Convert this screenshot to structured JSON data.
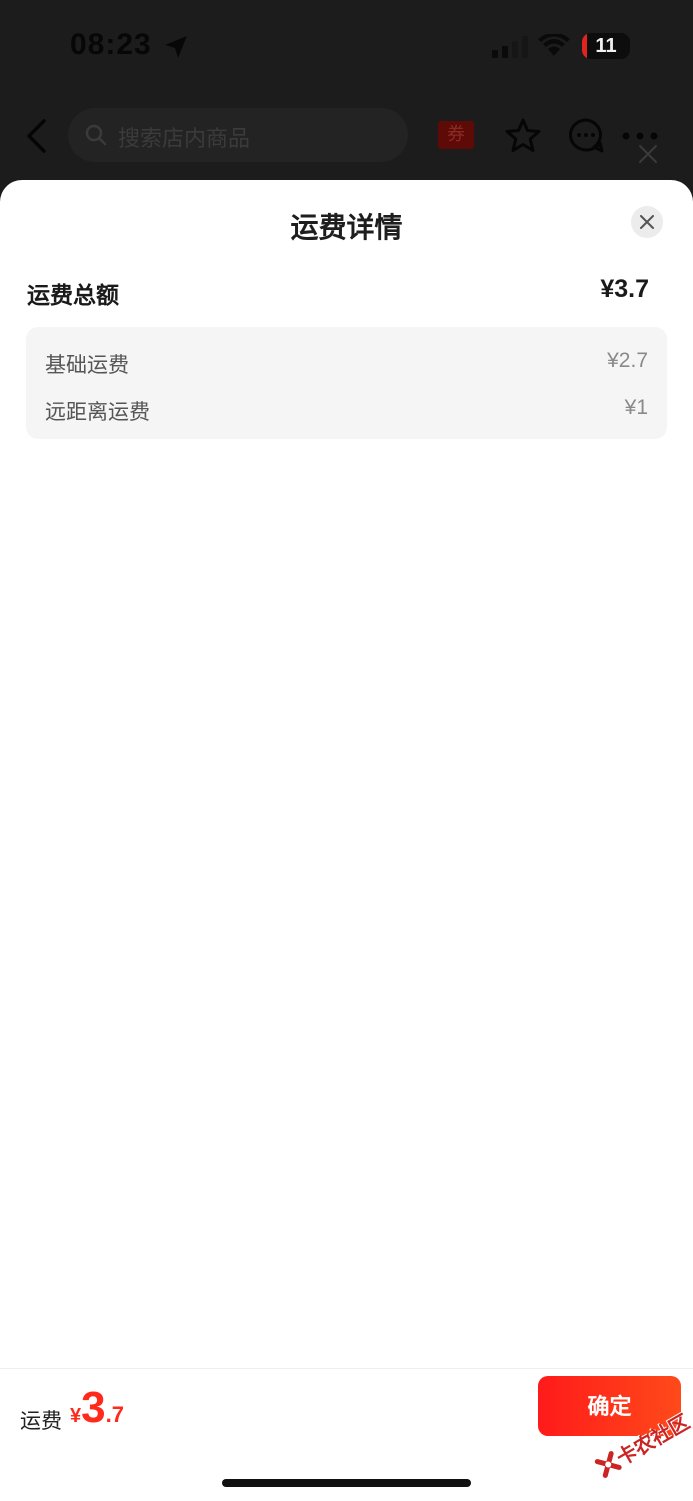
{
  "status_bar": {
    "time": "08:23",
    "battery": "11"
  },
  "header": {
    "search_placeholder": "搜索店内商品",
    "coupon_label": "券"
  },
  "sheet": {
    "title": "运费详情",
    "total_label": "运费总额",
    "total_amount": "¥3.7",
    "items": [
      {
        "label": "基础运费",
        "amount": "¥2.7"
      },
      {
        "label": "远距离运费",
        "amount": "¥1"
      }
    ]
  },
  "footer": {
    "label": "运费",
    "currency": "¥",
    "price_integer": "3",
    "price_decimal": ".7",
    "confirm_label": "确定"
  },
  "watermark": {
    "text": "卡农社区"
  },
  "colors": {
    "accent": "#ff2a1b",
    "button": "#ff1a1a"
  }
}
